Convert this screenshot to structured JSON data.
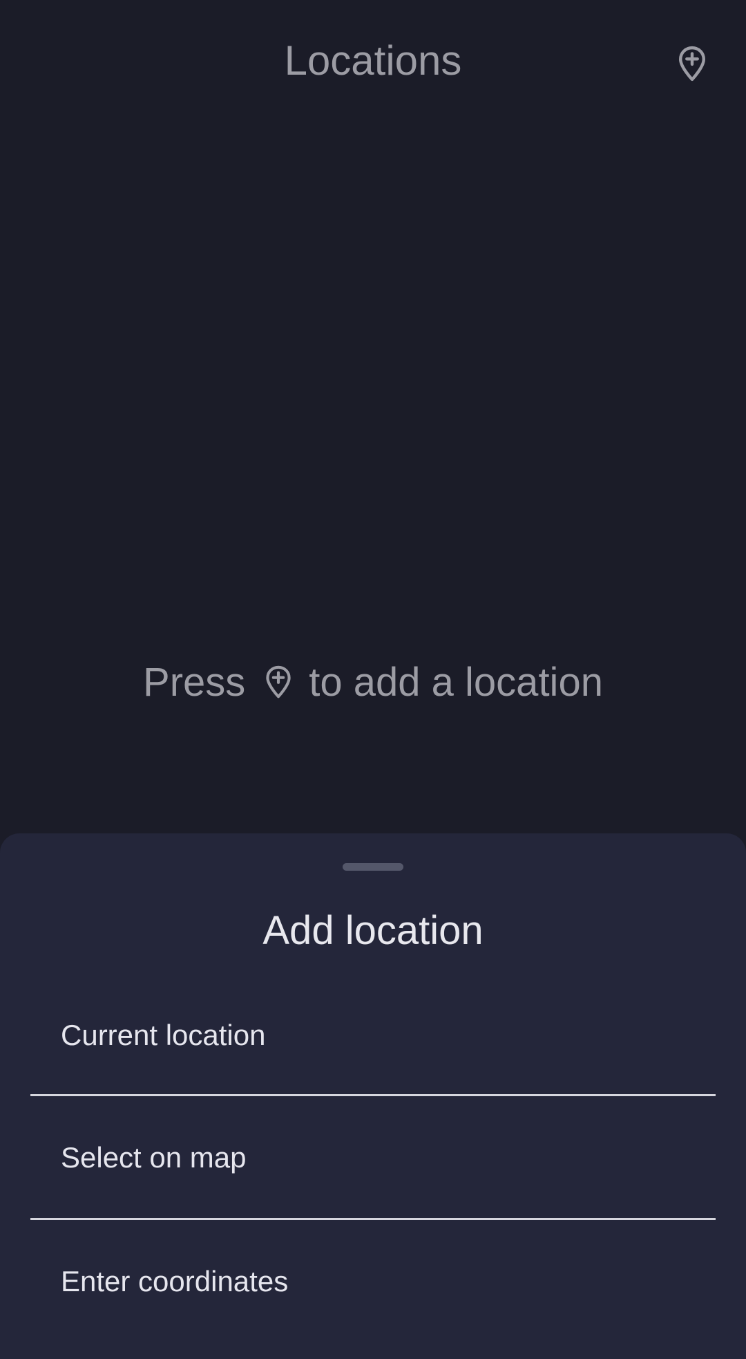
{
  "header": {
    "title": "Locations",
    "add_icon": "add-location-icon"
  },
  "empty_state": {
    "before_icon": "Press",
    "icon": "add-location-icon",
    "after_icon": "to add a location"
  },
  "sheet": {
    "title": "Add location",
    "options": [
      {
        "label": "Current location"
      },
      {
        "label": "Select on map"
      },
      {
        "label": "Enter coordinates"
      }
    ]
  },
  "colors": {
    "background": "#1b1c28",
    "sheet": "#24263a",
    "muted_text": "#9c9ca4",
    "primary_text": "#e6e6ee",
    "divider": "#d6d6de"
  }
}
